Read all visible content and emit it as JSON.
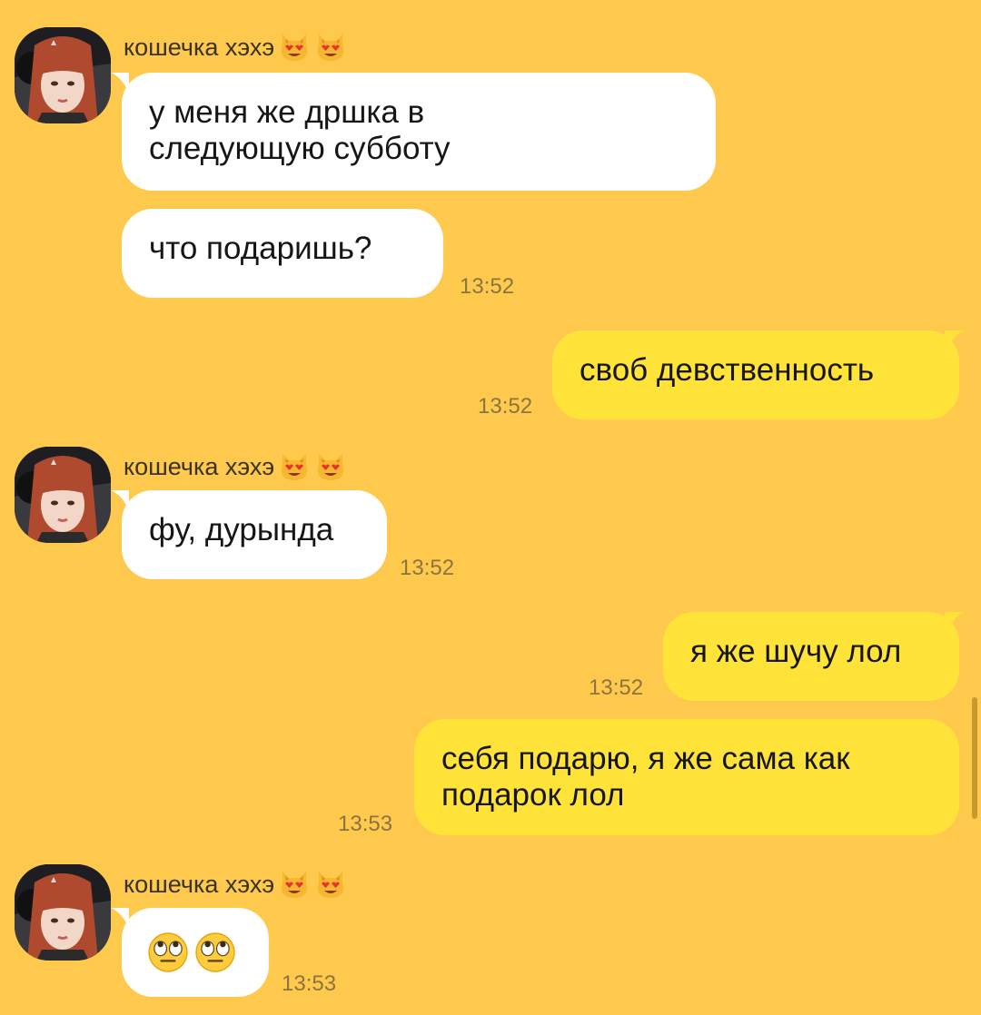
{
  "sender_name": "кошечка хэхэ",
  "sender_emoji": "heart-eyes-cat",
  "messages": [
    {
      "text_lines": [
        "у меня же дршка в",
        "следующую субботу"
      ]
    },
    {
      "text": "что подаришь?",
      "time": "13:52"
    },
    {
      "text": "своб девственность",
      "time": "13:52"
    },
    {
      "text": "фу, дурында",
      "time": "13:52"
    },
    {
      "text": "я же шучу лол",
      "time": "13:52"
    },
    {
      "text_lines": [
        "себя подарю, я же сама как",
        "подарок лол"
      ],
      "time": "13:53"
    },
    {
      "emoji": "rolling-eyes",
      "time": "13:53"
    }
  ],
  "colors": {
    "background": "#ffc94d",
    "incoming_bubble": "#ffffff",
    "outgoing_bubble": "#ffe338"
  }
}
